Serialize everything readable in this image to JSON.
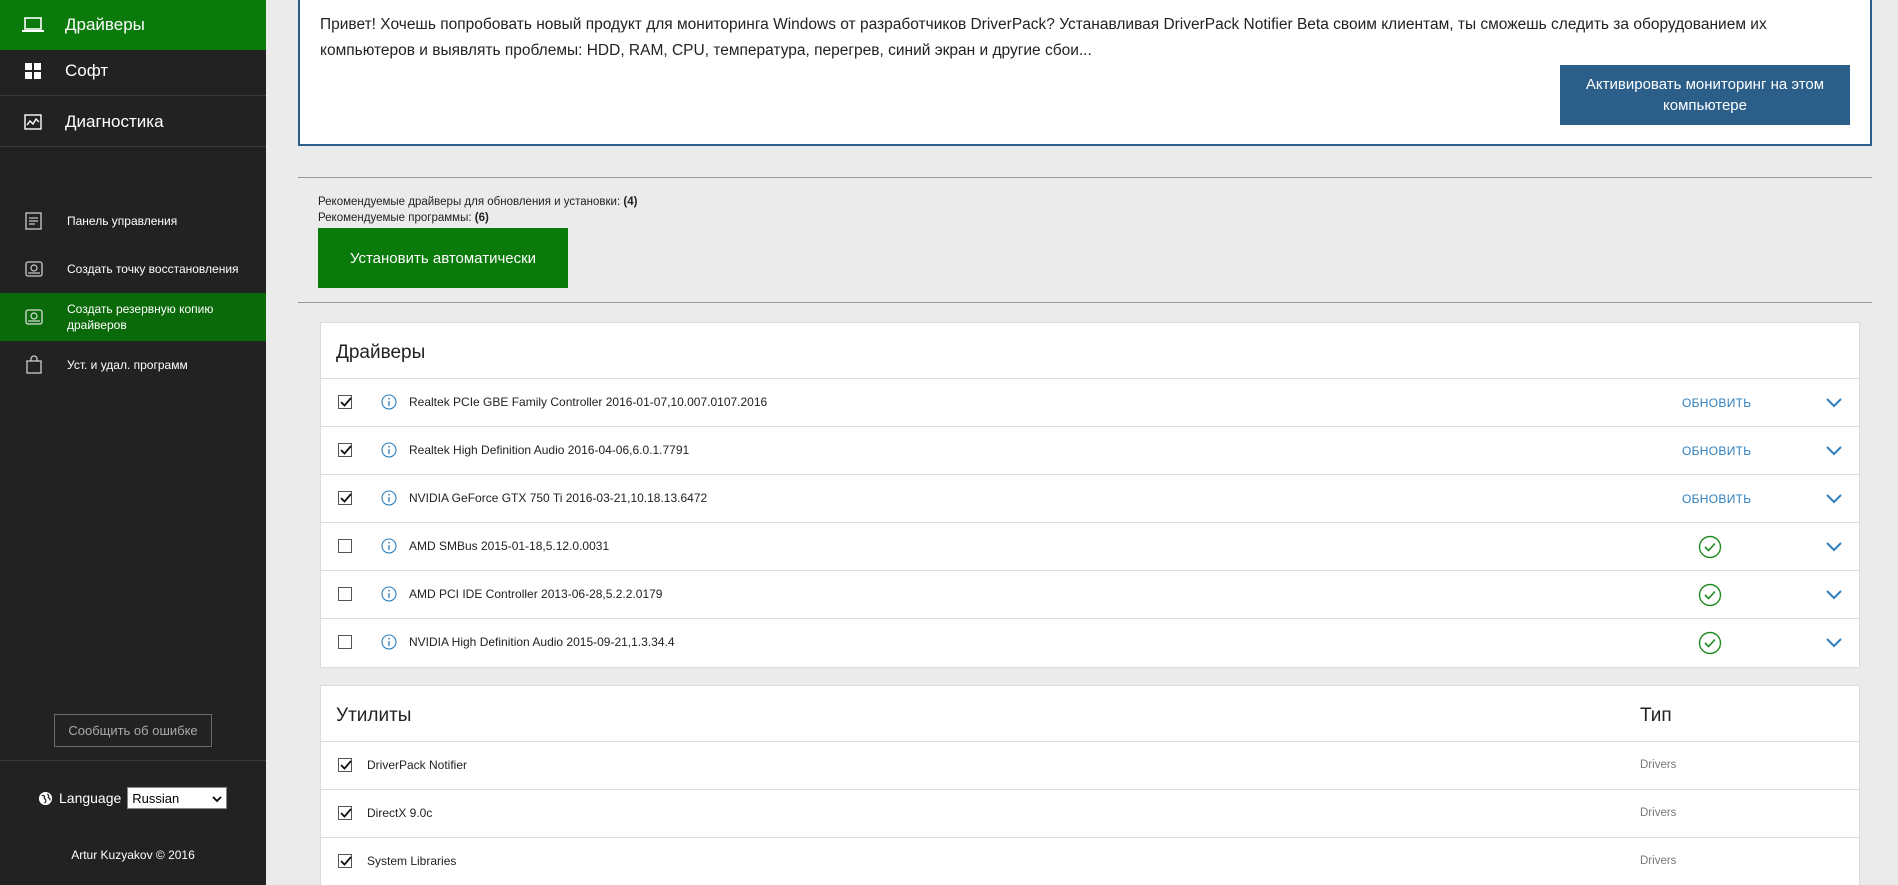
{
  "sidebar": {
    "nav": [
      {
        "label": "Драйверы",
        "icon": "laptop-icon",
        "active": true
      },
      {
        "label": "Софт",
        "icon": "grid-icon",
        "active": false
      },
      {
        "label": "Диагностика",
        "icon": "pulse-chart-icon",
        "active": false
      }
    ],
    "tools": [
      {
        "label": "Панель управления",
        "icon": "control-panel-icon",
        "active": false
      },
      {
        "label": "Создать точку восстановления",
        "icon": "restore-point-icon",
        "active": false
      },
      {
        "label": "Создать резервную копию драйверов",
        "icon": "backup-drive-icon",
        "active": true
      },
      {
        "label": "Уст. и удал. программ",
        "icon": "shopping-bag-icon",
        "active": false
      }
    ],
    "report_button": "Сообщить об ошибке",
    "language_label": "Language",
    "language_value": "Russian",
    "copyright": "Artur Kuzyakov © 2016"
  },
  "notice": {
    "text": "Привет! Хочешь попробовать новый продукт для мониторинга Windows от разработчиков DriverPack? Устанавливая DriverPack Notifier Beta своим клиентам, ты сможешь следить за оборудованием их компьютеров и выявлять проблемы: HDD, RAM, CPU, температура, перегрев, синий экран и другие сбои...",
    "button": "Активировать мониторинг на этом компьютере"
  },
  "summary": {
    "drivers_label": "Рекомендуемые драйверы для обновления и установки:",
    "drivers_count": "(4)",
    "programs_label": "Рекомендуемые программы:",
    "programs_count": "(6)"
  },
  "install_button": "Установить автоматически",
  "drivers": {
    "title": "Драйверы",
    "rows": [
      {
        "name": "Realtek PCIe GBE Family Controller 2016-01-07,10.007.0107.2016",
        "checked": true,
        "status": "update",
        "action": "ОБНОВИТЬ"
      },
      {
        "name": "Realtek High Definition Audio 2016-04-06,6.0.1.7791",
        "checked": true,
        "status": "update",
        "action": "ОБНОВИТЬ"
      },
      {
        "name": "NVIDIA GeForce GTX 750 Ti 2016-03-21,10.18.13.6472",
        "checked": true,
        "status": "update",
        "action": "ОБНОВИТЬ"
      },
      {
        "name": "AMD SMBus 2015-01-18,5.12.0.0031",
        "checked": false,
        "status": "ok",
        "action": ""
      },
      {
        "name": "AMD PCI IDE Controller 2013-06-28,5.2.2.0179",
        "checked": false,
        "status": "ok",
        "action": ""
      },
      {
        "name": "NVIDIA High Definition Audio 2015-09-21,1.3.34.4",
        "checked": false,
        "status": "ok",
        "action": ""
      }
    ]
  },
  "utilities": {
    "title": "Утилиты",
    "type_header": "Тип",
    "rows": [
      {
        "name": "DriverPack Notifier",
        "type": "Drivers",
        "checked": true
      },
      {
        "name": "DirectX 9.0c",
        "type": "Drivers",
        "checked": true
      },
      {
        "name": "System Libraries",
        "type": "Drivers",
        "checked": true
      }
    ]
  },
  "colors": {
    "sidebar_bg": "#222222",
    "accent_green": "#0a7a0a",
    "accent_blue": "#2b5f8a",
    "link_blue": "#2e7fbe",
    "ok_green": "#1e8a1e"
  }
}
